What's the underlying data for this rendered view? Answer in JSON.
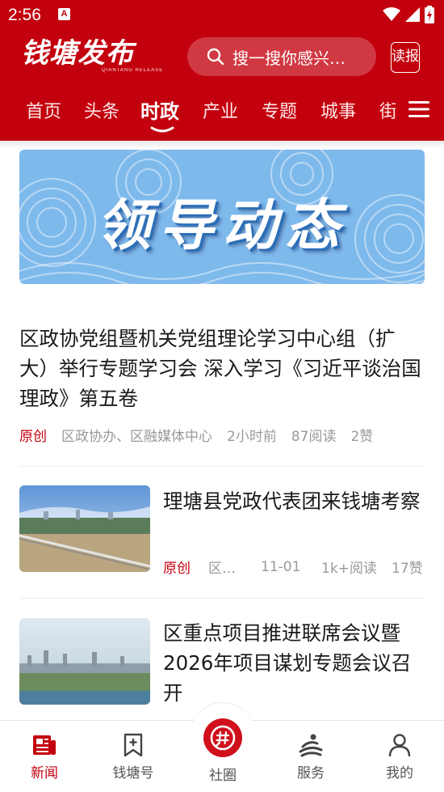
{
  "status_bar": {
    "time": "2:56",
    "notification_badge": "A"
  },
  "header": {
    "logo_text": "钱塘发布",
    "logo_subtitle": "QIANTANG RELEASE",
    "search_placeholder": "搜一搜你感兴…",
    "read_button": "读报"
  },
  "tabs": [
    {
      "label": "首页",
      "active": false
    },
    {
      "label": "头条",
      "active": false
    },
    {
      "label": "时政",
      "active": true
    },
    {
      "label": "产业",
      "active": false
    },
    {
      "label": "专题",
      "active": false
    },
    {
      "label": "城事",
      "active": false
    },
    {
      "label": "街",
      "active": false
    }
  ],
  "banner": {
    "title": "领导动态"
  },
  "articles": [
    {
      "title": "区政协党组暨机关党组理论学习中心组（扩大）举行专题学习会 深入学习《习近平谈治国理政》第五卷",
      "tag": "原创",
      "source": "区政协办、区融媒体中心",
      "time": "2小时前",
      "reads": "87阅读",
      "likes": "2赞"
    },
    {
      "title": "理塘县党政代表团来钱塘考察",
      "tag": "原创",
      "source": "区…",
      "time": "11-01",
      "reads": "1k+阅读",
      "likes": "17赞"
    },
    {
      "title": "区重点项目推进联席会议暨2026年项目谋划专题会议召开"
    }
  ],
  "bottom_nav": [
    {
      "label": "新闻",
      "icon": "news-icon",
      "active": true
    },
    {
      "label": "钱塘号",
      "icon": "bookmark-add-icon",
      "active": false
    },
    {
      "label": "社圈",
      "icon": "hashtag-icon",
      "active": false
    },
    {
      "label": "服务",
      "icon": "service-icon",
      "active": false
    },
    {
      "label": "我的",
      "icon": "user-icon",
      "active": false
    }
  ],
  "colors": {
    "brand_red": "#c3000d",
    "banner_blue": "#7eb9ec",
    "meta_gray": "#999999"
  }
}
